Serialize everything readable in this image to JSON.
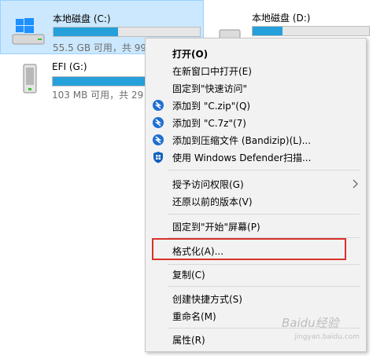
{
  "drives": {
    "c": {
      "name": "本地磁盘 (C:)",
      "size_text": "55.5 GB 可用，共 99",
      "used_fraction": 0.44
    },
    "d": {
      "name": "本地磁盘 (D:)",
      "size_text": "",
      "used_fraction": 0.26
    },
    "g": {
      "name": "EFI (G:)",
      "size_text": "103 MB 可用，共 29",
      "used_fraction": 0.63
    }
  },
  "icons": {
    "drive_c": "windows-drive-icon",
    "drive_d": "hard-drive-icon",
    "drive_g": "usb-drive-icon",
    "bandizip": "bandizip-icon",
    "defender": "windows-defender-icon",
    "submenu": "chevron-right-icon"
  },
  "context_menu": {
    "items": [
      {
        "label": "打开(O)"
      },
      {
        "label": "在新窗口中打开(E)"
      },
      {
        "label": "固定到\"快速访问\""
      },
      {
        "label": "添加到 \"C.zip\"(Q)"
      },
      {
        "label": "添加到 \"C.7z\"(7)"
      },
      {
        "label": "添加到压缩文件 (Bandizip)(L)..."
      },
      {
        "label": "使用 Windows Defender扫描..."
      },
      {
        "label": "授予访问权限(G)"
      },
      {
        "label": "还原以前的版本(V)"
      },
      {
        "label": "固定到\"开始\"屏幕(P)"
      },
      {
        "label": "格式化(A)..."
      },
      {
        "label": "复制(C)"
      },
      {
        "label": "创建快捷方式(S)"
      },
      {
        "label": "重命名(M)"
      },
      {
        "label": "属性(R)"
      }
    ]
  },
  "colors": {
    "selection_bg": "#cce8ff",
    "bar_fill": "#26a0da",
    "highlight_box": "#d9312d",
    "bandizip_blue": "#1f6fd1"
  },
  "watermark": {
    "main": "Baidu经验",
    "sub": "jingyan.baidu.com"
  }
}
